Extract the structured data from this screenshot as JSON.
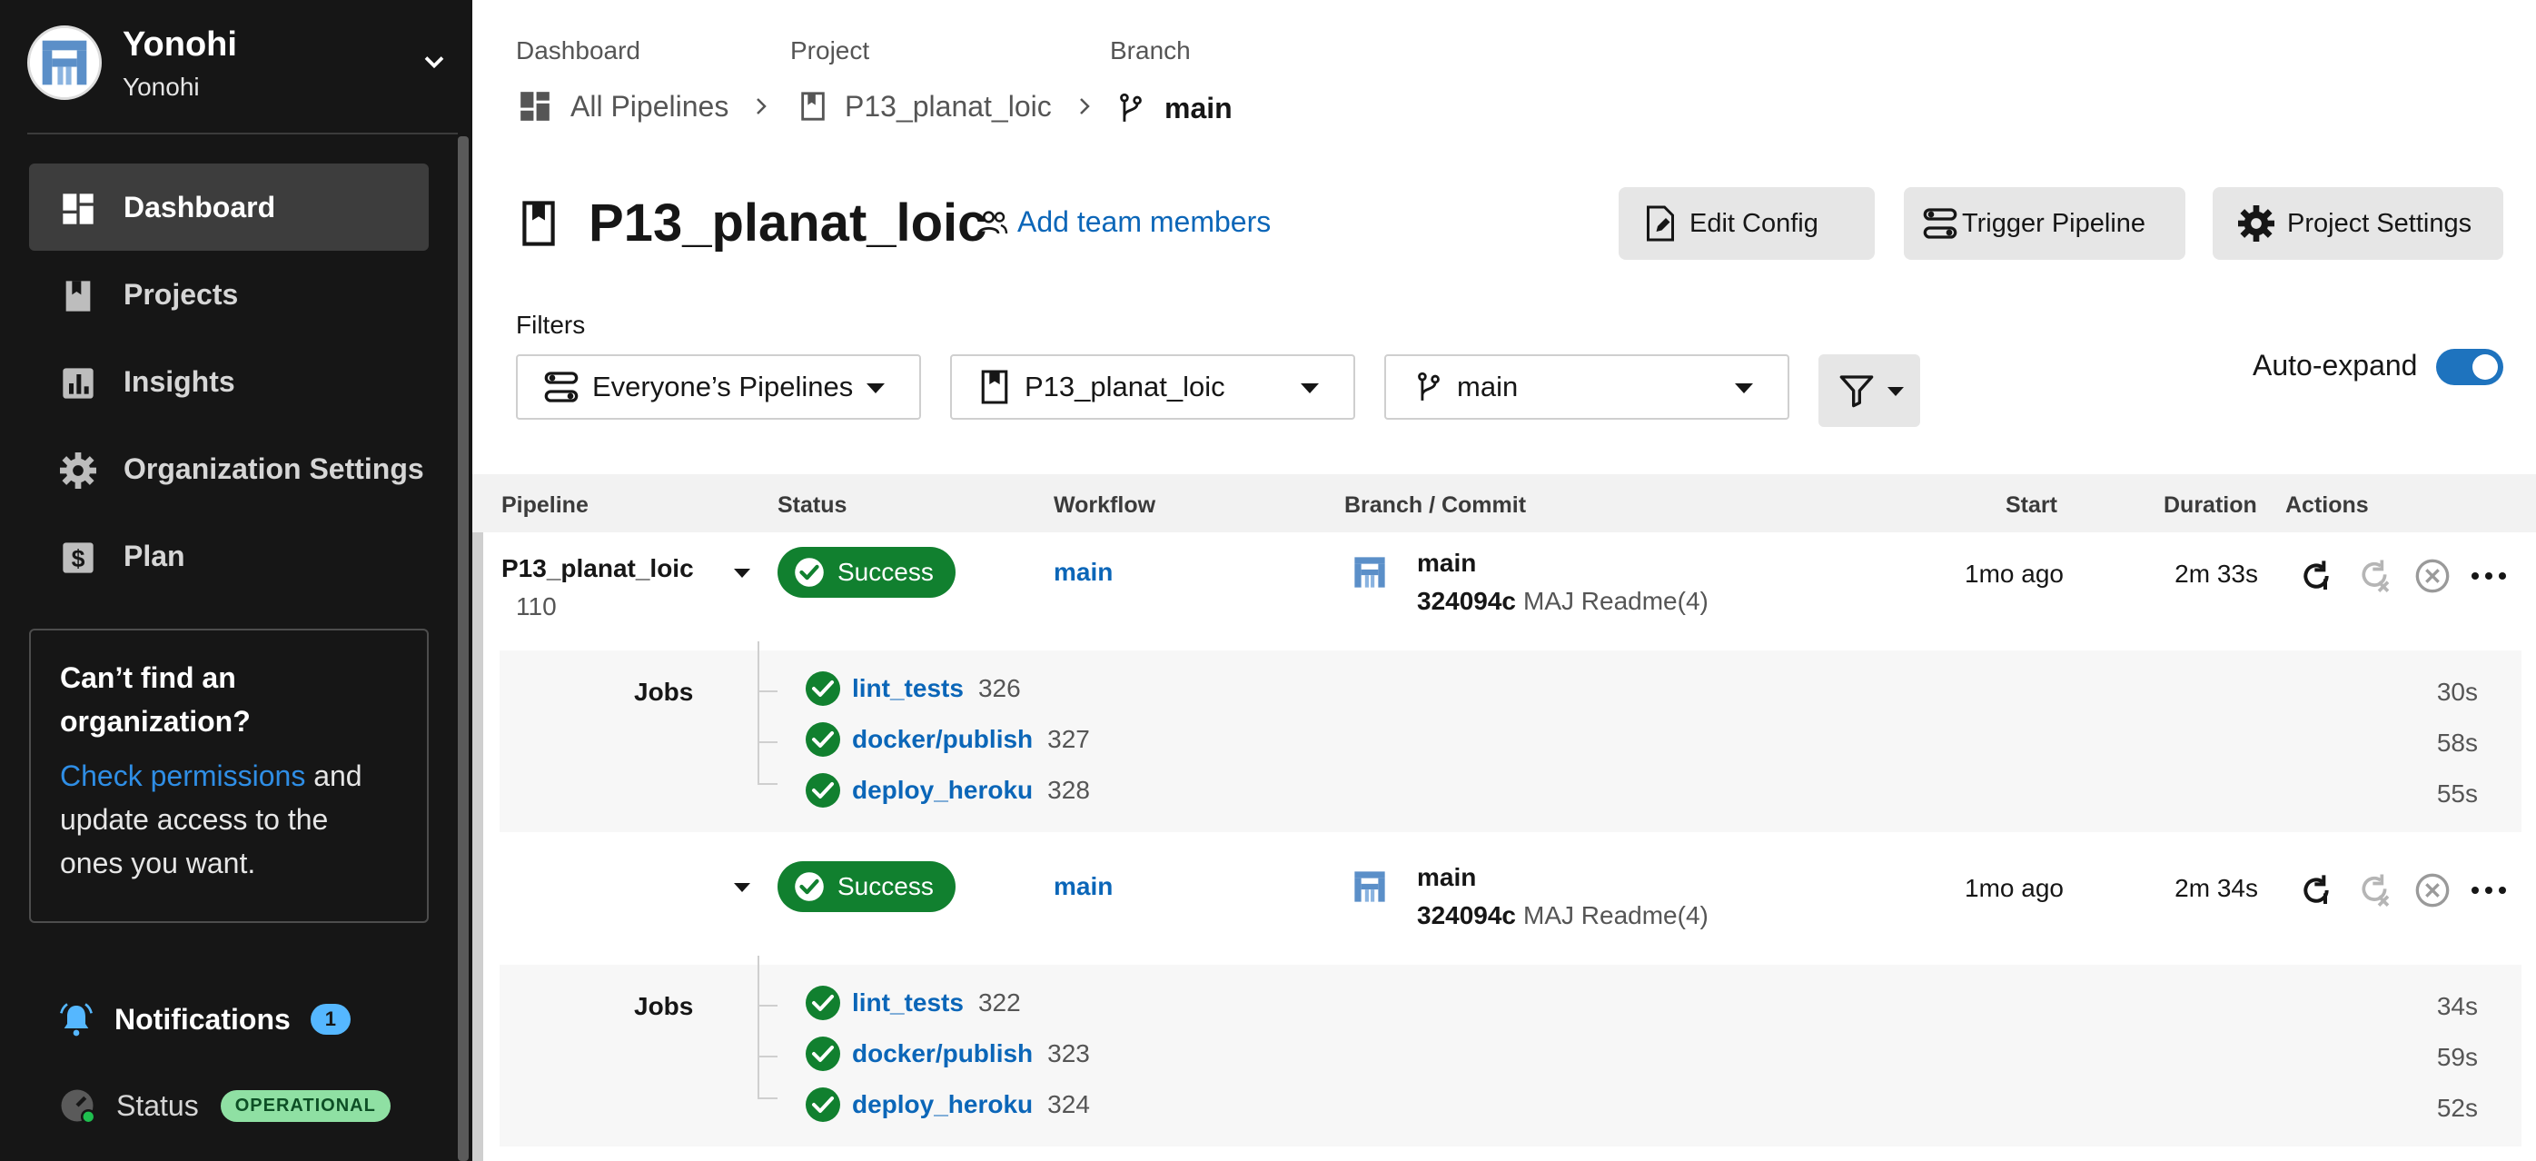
{
  "org": {
    "name": "Yonohi",
    "sub": "Yonohi"
  },
  "nav": [
    {
      "label": "Dashboard",
      "icon": "dashboard-icon",
      "active": true
    },
    {
      "label": "Projects",
      "icon": "projects-icon"
    },
    {
      "label": "Insights",
      "icon": "insights-icon"
    },
    {
      "label": "Organization Settings",
      "icon": "gear-icon"
    },
    {
      "label": "Plan",
      "icon": "plan-icon"
    }
  ],
  "hint": {
    "title": "Can’t find an organization?",
    "link": "Check permissions",
    "rest": " and update access to the ones you want."
  },
  "notifications": {
    "label": "Notifications",
    "count": "1"
  },
  "status": {
    "label": "Status",
    "badge": "OPERATIONAL"
  },
  "breadcrumb": {
    "dashboard_label": "Dashboard",
    "dashboard_value": "All Pipelines",
    "project_label": "Project",
    "project_value": "P13_planat_loic",
    "branch_label": "Branch",
    "branch_value": "main"
  },
  "page": {
    "title": "P13_planat_loic",
    "add_team": "Add team members"
  },
  "buttons": {
    "edit_config": "Edit Config",
    "trigger": "Trigger Pipeline",
    "settings": "Project Settings"
  },
  "filters": {
    "label": "Filters",
    "pipelines": "Everyone’s Pipelines",
    "project": "P13_planat_loic",
    "branch": "main",
    "auto_expand": "Auto-expand"
  },
  "table": {
    "headers": {
      "pipeline": "Pipeline",
      "status": "Status",
      "workflow": "Workflow",
      "branch_commit": "Branch / Commit",
      "start": "Start",
      "duration": "Duration",
      "actions": "Actions"
    },
    "rows": [
      {
        "pipeline": "P13_planat_loic",
        "number": "110",
        "status": "Success",
        "workflow": "main",
        "branch": "main",
        "hash": "324094c",
        "message": "MAJ Readme(4)",
        "start": "1mo ago",
        "duration": "2m 33s",
        "jobs_label": "Jobs",
        "jobs": [
          {
            "name": "lint_tests",
            "id": "326",
            "duration": "30s"
          },
          {
            "name": "docker/publish",
            "id": "327",
            "duration": "58s"
          },
          {
            "name": "deploy_heroku",
            "id": "328",
            "duration": "55s"
          }
        ]
      },
      {
        "pipeline": "",
        "number": "",
        "status": "Success",
        "workflow": "main",
        "branch": "main",
        "hash": "324094c",
        "message": "MAJ Readme(4)",
        "start": "1mo ago",
        "duration": "2m 34s",
        "jobs_label": "Jobs",
        "jobs": [
          {
            "name": "lint_tests",
            "id": "322",
            "duration": "34s"
          },
          {
            "name": "docker/publish",
            "id": "323",
            "duration": "59s"
          },
          {
            "name": "deploy_heroku",
            "id": "324",
            "duration": "52s"
          }
        ]
      }
    ]
  },
  "colors": {
    "success": "#11802f",
    "link": "#0b66b8",
    "sidebar": "#161616",
    "toggle": "#1e73be"
  }
}
